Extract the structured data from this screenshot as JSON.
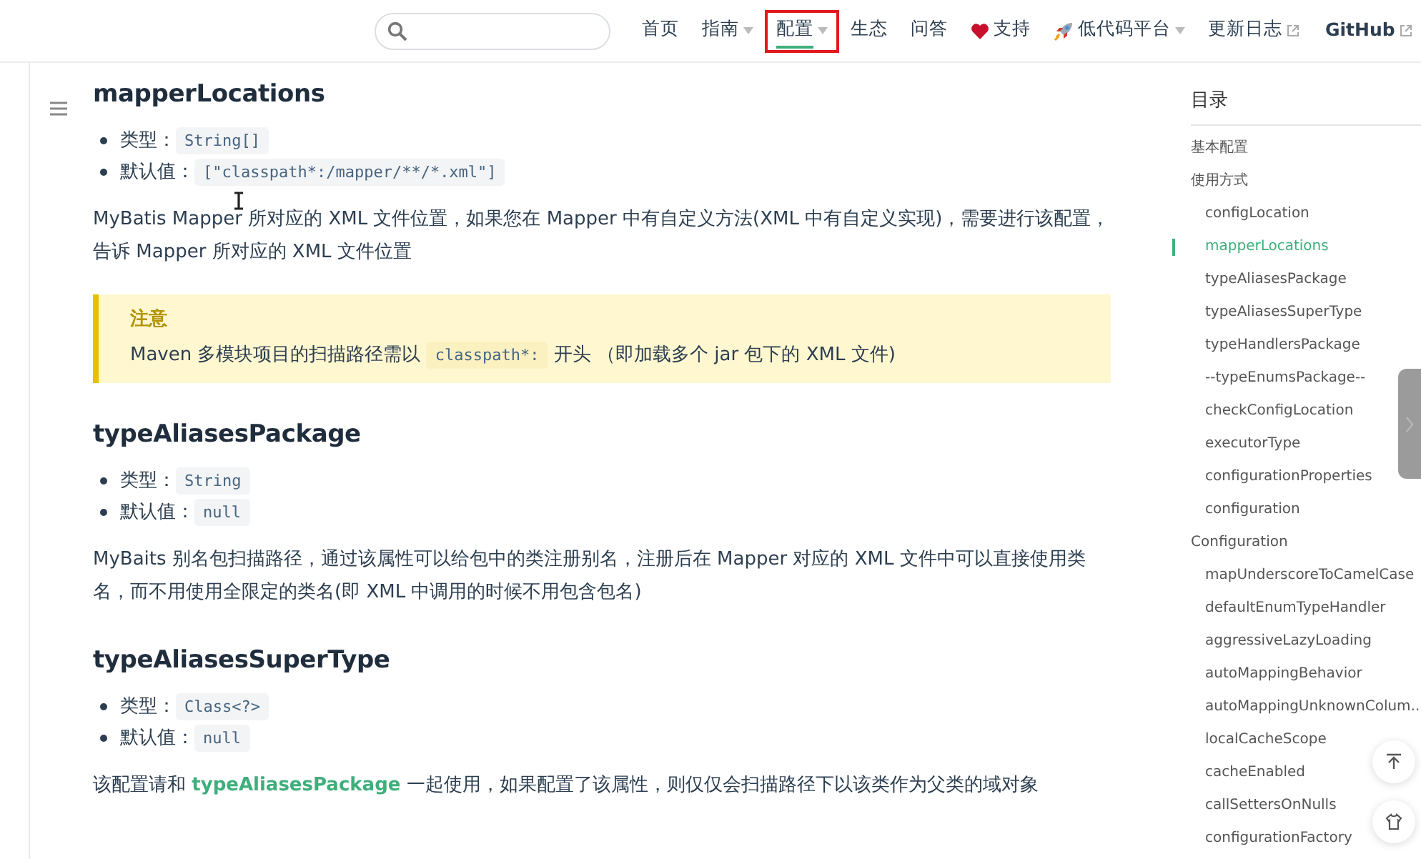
{
  "navbar": {
    "items": [
      {
        "label": "首页",
        "kind": "plain",
        "selected": false
      },
      {
        "label": "指南",
        "kind": "dropdown",
        "selected": false
      },
      {
        "label": "配置",
        "kind": "dropdown",
        "selected": true,
        "highlighted": true
      },
      {
        "label": "生态",
        "kind": "plain",
        "selected": false
      },
      {
        "label": "问答",
        "kind": "plain",
        "selected": false
      },
      {
        "label": "支持",
        "kind": "heart",
        "selected": false
      },
      {
        "label": "低代码平台",
        "kind": "rocket-dropdown",
        "selected": false
      },
      {
        "label": "更新日志",
        "kind": "external",
        "selected": false
      },
      {
        "label": "GitHub",
        "kind": "external",
        "selected": false
      }
    ]
  },
  "sections": [
    {
      "title": "mapperLocations",
      "props": [
        {
          "label": "类型：",
          "code": "String[]"
        },
        {
          "label": "默认值：",
          "code": "[\"classpath*:/mapper/**/*.xml\"]"
        }
      ],
      "description": [
        {
          "kind": "text",
          "text": "MyBatis Mapper 所对应的 XML 文件位置，如果您在 Mapper 中有自定义方法(XML 中有自定义实现)，需要进行该配置，告诉 Mapper 所对应的 XML 文件位置"
        }
      ],
      "tip": {
        "title": "注意",
        "parts": [
          {
            "kind": "text",
            "text": "Maven 多模块项目的扫描路径需以 "
          },
          {
            "kind": "code",
            "text": "classpath*:"
          },
          {
            "kind": "text",
            "text": " 开头 （即加载多个 jar 包下的 XML 文件)"
          }
        ]
      }
    },
    {
      "title": "typeAliasesPackage",
      "props": [
        {
          "label": "类型：",
          "code": "String"
        },
        {
          "label": "默认值：",
          "code": "null"
        }
      ],
      "description": [
        {
          "kind": "text",
          "text": "MyBaits 别名包扫描路径，通过该属性可以给包中的类注册别名，注册后在 Mapper 对应的 XML 文件中可以直接使用类名，而不用使用全限定的类名(即 XML 中调用的时候不用包含包名)"
        }
      ]
    },
    {
      "title": "typeAliasesSuperType",
      "props": [
        {
          "label": "类型：",
          "code": "Class<?>"
        },
        {
          "label": "默认值：",
          "code": "null"
        }
      ],
      "description": [
        {
          "kind": "text",
          "text": "该配置请和 "
        },
        {
          "kind": "link",
          "text": "typeAliasesPackage"
        },
        {
          "kind": "text",
          "text": " 一起使用，如果配置了该属性，则仅仅会扫描路径下以该类作为父类的域对象"
        }
      ]
    }
  ],
  "toc": {
    "title": "目录",
    "items": [
      {
        "label": "基本配置",
        "selected": false
      },
      {
        "label": "使用方式",
        "selected": false,
        "children": [
          {
            "label": "configLocation",
            "selected": false
          },
          {
            "label": "mapperLocations",
            "selected": true
          },
          {
            "label": "typeAliasesPackage",
            "selected": false
          },
          {
            "label": "typeAliasesSuperType",
            "selected": false
          },
          {
            "label": "typeHandlersPackage",
            "selected": false
          },
          {
            "label": "--typeEnumsPackage--",
            "selected": false
          },
          {
            "label": "checkConfigLocation",
            "selected": false
          },
          {
            "label": "executorType",
            "selected": false
          },
          {
            "label": "configurationProperties",
            "selected": false
          },
          {
            "label": "configuration",
            "selected": false
          }
        ]
      },
      {
        "label": "Configuration",
        "selected": false,
        "children": [
          {
            "label": "mapUnderscoreToCamelCase",
            "selected": false
          },
          {
            "label": "defaultEnumTypeHandler",
            "selected": false
          },
          {
            "label": "aggressiveLazyLoading",
            "selected": false
          },
          {
            "label": "autoMappingBehavior",
            "selected": false
          },
          {
            "label": "autoMappingUnknownColum...",
            "selected": false
          },
          {
            "label": "localCacheScope",
            "selected": false
          },
          {
            "label": "cacheEnabled",
            "selected": false
          },
          {
            "label": "callSettersOnNulls",
            "selected": false
          },
          {
            "label": "configurationFactory",
            "selected": false
          }
        ]
      }
    ]
  }
}
